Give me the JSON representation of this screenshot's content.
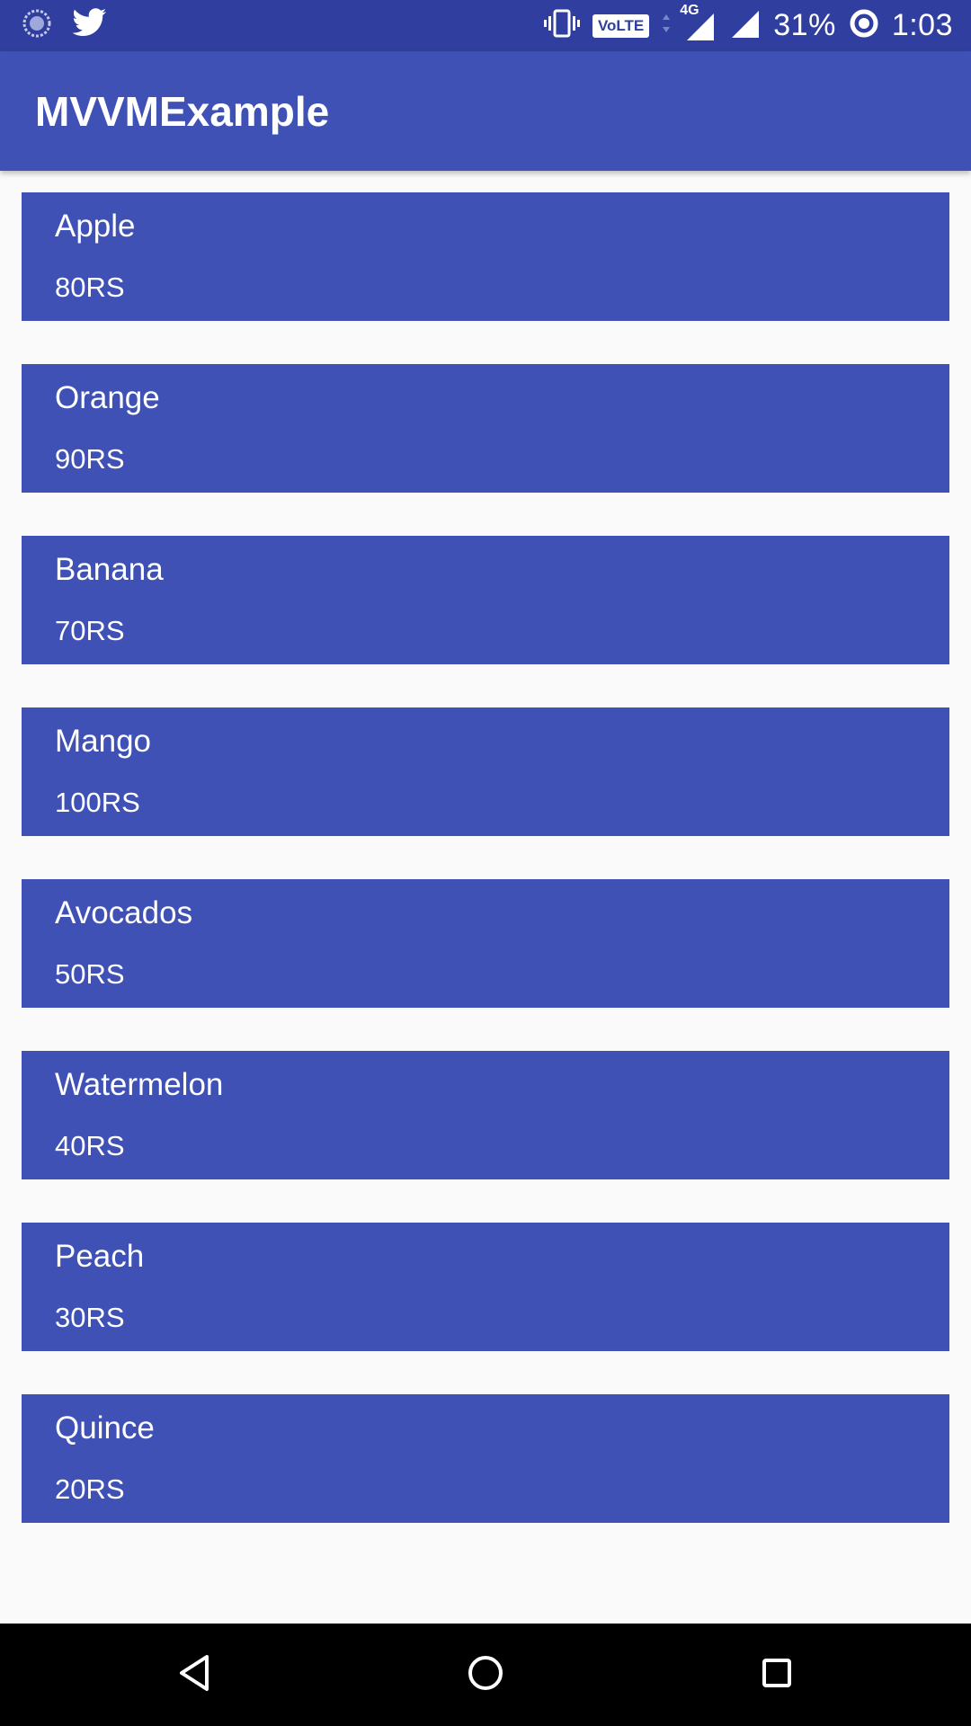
{
  "status_bar": {
    "network_type": "4G",
    "volte_label": "VoLTE",
    "battery_percent": "31%",
    "time": "1:03"
  },
  "app_bar": {
    "title": "MVVMExample"
  },
  "fruits": [
    {
      "name": "Apple",
      "price": "80RS"
    },
    {
      "name": "Orange",
      "price": "90RS"
    },
    {
      "name": "Banana",
      "price": "70RS"
    },
    {
      "name": "Mango",
      "price": "100RS"
    },
    {
      "name": "Avocados",
      "price": "50RS"
    },
    {
      "name": "Watermelon",
      "price": "40RS"
    },
    {
      "name": "Peach",
      "price": "30RS"
    },
    {
      "name": "Quince",
      "price": "20RS"
    }
  ],
  "colors": {
    "status_bar": "#303f9f",
    "primary": "#3f51b5",
    "background": "#fafafa"
  }
}
